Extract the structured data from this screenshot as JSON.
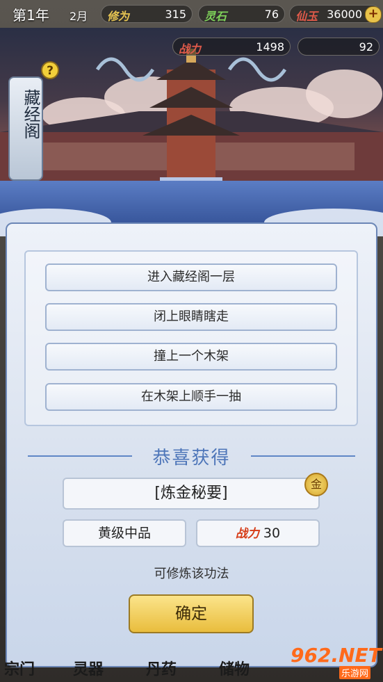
{
  "topbar": {
    "year": "第1年",
    "month": "2月",
    "cultivation": {
      "label": "修为",
      "value": "315"
    },
    "spirit_stone": {
      "label": "灵石",
      "value": "76"
    },
    "jade": {
      "label": "仙玉",
      "value": "36000"
    },
    "jade_plus": "+"
  },
  "status2": {
    "power": {
      "label": "战力",
      "value": "1498"
    },
    "qi": {
      "value": "92"
    }
  },
  "location": {
    "title": "藏经阁",
    "help": "?"
  },
  "options": [
    "进入藏经阁一层",
    "闭上眼睛瞎走",
    "撞上一个木架",
    "在木架上顺手一抽"
  ],
  "reward": {
    "title": "恭喜获得",
    "item": "[炼金秘要]",
    "badge": "金",
    "grade": "黄级中品",
    "power_label": "战力",
    "power_value": "30",
    "description": "可修炼该功法",
    "confirm": "确定"
  },
  "bottom_nav": [
    "宗门",
    "灵器",
    "丹药",
    "储物"
  ],
  "watermark": {
    "brand": "962.NET",
    "sub": "乐游网"
  }
}
